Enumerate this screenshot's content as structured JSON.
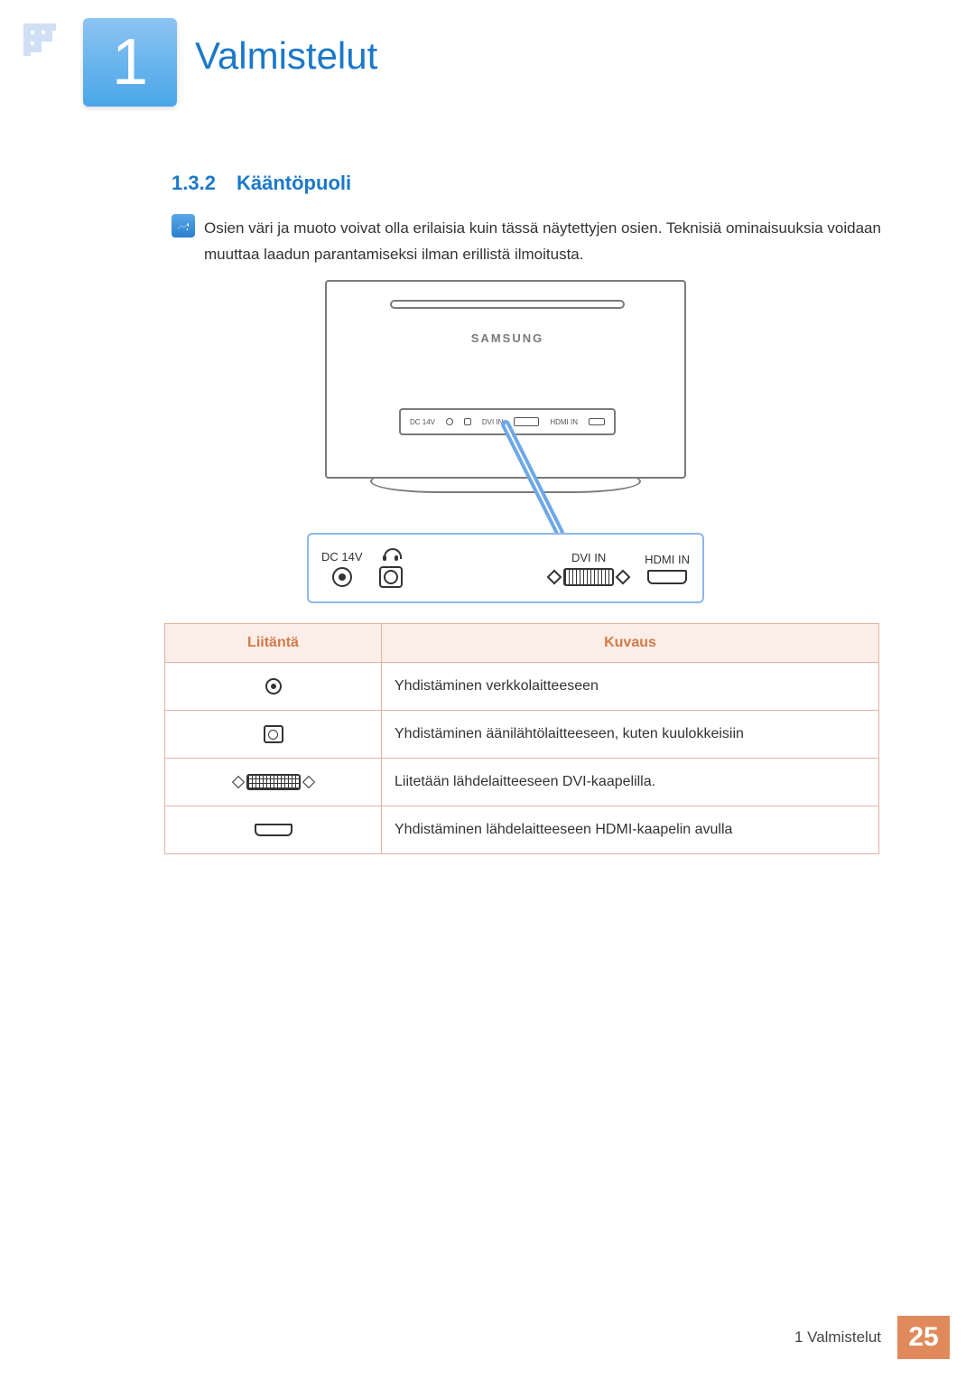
{
  "chapter": {
    "number": "1",
    "title": "Valmistelut"
  },
  "section": {
    "number": "1.3.2",
    "title": "Kääntöpuoli"
  },
  "note": "Osien väri ja muoto voivat olla erilaisia kuin tässä näytettyjen osien. Teknisiä ominaisuuksia voidaan muuttaa laadun parantamiseksi ilman erillistä ilmoitusta.",
  "diagram": {
    "brand": "SAMSUNG",
    "port_labels": {
      "dc": "DC 14V",
      "dvi": "DVI IN",
      "hdmi": "HDMI IN"
    }
  },
  "table": {
    "headers": {
      "port": "Liitäntä",
      "desc": "Kuvaus"
    },
    "rows": [
      {
        "icon": "dc-icon",
        "desc": "Yhdistäminen verkkolaitteeseen"
      },
      {
        "icon": "audio-icon",
        "desc": "Yhdistäminen äänilähtölaitteeseen, kuten kuulokkeisiin"
      },
      {
        "icon": "dvi-icon",
        "desc": "Liitetään lähdelaitteeseen DVI-kaapelilla."
      },
      {
        "icon": "hdmi-icon",
        "desc": "Yhdistäminen lähdelaitteeseen HDMI-kaapelin avulla"
      }
    ]
  },
  "footer": {
    "text": "1 Valmistelut",
    "page": "25"
  }
}
